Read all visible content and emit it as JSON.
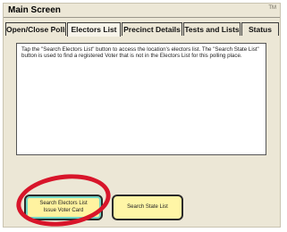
{
  "window": {
    "title": "Main Screen",
    "corner_mark": "TM"
  },
  "tabs": [
    {
      "label": "Open/Close Polls"
    },
    {
      "label": "Electors List"
    },
    {
      "label": "Precinct Details"
    },
    {
      "label": "Tests and Lists"
    },
    {
      "label": "Status"
    }
  ],
  "active_tab": "Electors List",
  "panel": {
    "text": "Tap the \"Search Electors List\" button to access the location's electors list. The \"Search State List\" button is used to find a registered Voter that is not in the Electors List for this polling place."
  },
  "buttons": {
    "search_electors_line1": "Search Electors List",
    "search_electors_line2": "Issue Voter Card",
    "search_state": "Search State List"
  },
  "colors": {
    "annotation_ring": "#d8152a",
    "button_fill": "#fff6a6",
    "highlight": "#6fd6c6"
  }
}
